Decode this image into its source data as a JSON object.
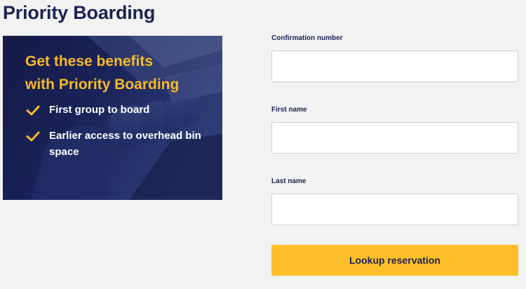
{
  "page": {
    "title": "Priority Boarding"
  },
  "benefits": {
    "heading_line1": "Get these benefits",
    "heading_line2": "with Priority Boarding",
    "items": [
      {
        "icon": "check-icon",
        "text": "First group to board"
      },
      {
        "icon": "check-icon",
        "text": "Earlier access to overhead bin space"
      }
    ]
  },
  "form": {
    "confirmation": {
      "label": "Confirmation number",
      "value": "",
      "placeholder": ""
    },
    "first_name": {
      "label": "First name",
      "value": "",
      "placeholder": ""
    },
    "last_name": {
      "label": "Last name",
      "value": "",
      "placeholder": ""
    },
    "submit_label": "Lookup reservation"
  },
  "colors": {
    "title": "#1b2352",
    "accent": "#f7b928",
    "button": "#fdbe27",
    "panel": "#1b2456",
    "background": "#f2f2f2"
  }
}
